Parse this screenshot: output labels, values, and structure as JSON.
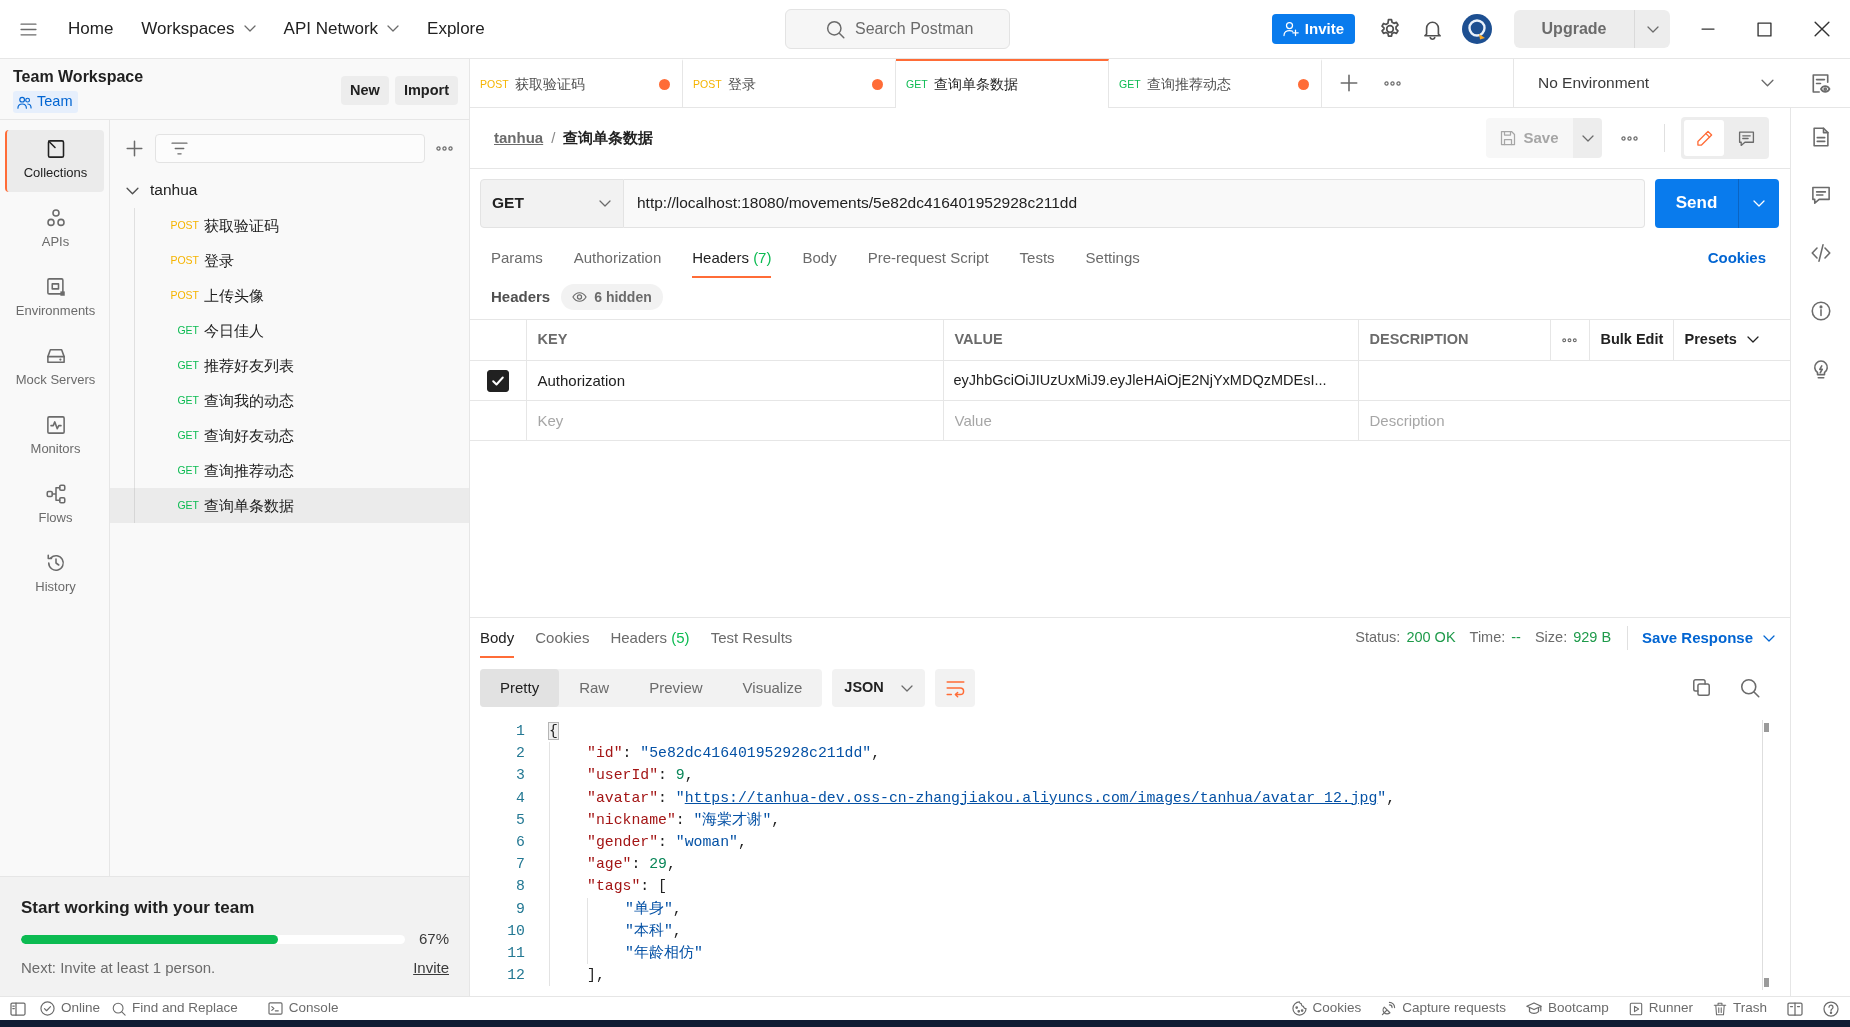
{
  "header": {
    "nav": [
      {
        "label": "Home",
        "dropdown": false
      },
      {
        "label": "Workspaces",
        "dropdown": true
      },
      {
        "label": "API Network",
        "dropdown": true
      },
      {
        "label": "Explore",
        "dropdown": false
      }
    ],
    "search": {
      "placeholder": "Search Postman"
    },
    "invite": "Invite",
    "upgrade": "Upgrade"
  },
  "workspace": {
    "title": "Team Workspace",
    "type": "Team",
    "buttons": [
      "New",
      "Import"
    ]
  },
  "sidebar_nav": [
    {
      "kind": "collections",
      "label": "Collections",
      "selected": true
    },
    {
      "kind": "apis",
      "label": "APIs",
      "selected": false
    },
    {
      "kind": "environments",
      "label": "Environments",
      "selected": false
    },
    {
      "kind": "mock_servers",
      "label": "Mock Servers",
      "selected": false
    },
    {
      "kind": "monitors",
      "label": "Monitors",
      "selected": false
    },
    {
      "kind": "flows",
      "label": "Flows",
      "selected": false
    },
    {
      "kind": "history",
      "label": "History",
      "selected": false
    }
  ],
  "collections": [
    {
      "name": "tanhua",
      "expanded": true,
      "children": [
        {
          "method": "POST",
          "color": "#f5b400",
          "name": "获取验证码",
          "selected": false
        },
        {
          "method": "POST",
          "color": "#f5b400",
          "name": "登录",
          "selected": false
        },
        {
          "method": "POST",
          "color": "#f5b400",
          "name": "上传头像",
          "selected": false
        },
        {
          "method": "GET",
          "color": "#0cbb52",
          "name": "今日佳人",
          "selected": false
        },
        {
          "method": "GET",
          "color": "#0cbb52",
          "name": "推荐好友列表",
          "selected": false
        },
        {
          "method": "GET",
          "color": "#0cbb52",
          "name": "查询我的动态",
          "selected": false
        },
        {
          "method": "GET",
          "color": "#0cbb52",
          "name": "查询好友动态",
          "selected": false
        },
        {
          "method": "GET",
          "color": "#0cbb52",
          "name": "查询推荐动态",
          "selected": false
        },
        {
          "method": "GET",
          "color": "#0cbb52",
          "name": "查询单条数据",
          "selected": true
        }
      ]
    }
  ],
  "team_card": {
    "title": "Start working with your team",
    "level": 0.67,
    "reading": "67%",
    "note": "Next: Invite at least 1 person.",
    "link": "Invite"
  },
  "request_tabs": [
    {
      "method": "POST",
      "color": "#f5b400",
      "name": "获取验证码",
      "selected": false,
      "unsaved": true
    },
    {
      "method": "POST",
      "color": "#f5b400",
      "name": "登录",
      "selected": false,
      "unsaved": true
    },
    {
      "method": "GET",
      "color": "#0cbb52",
      "name": "查询单条数据",
      "selected": true,
      "unsaved": false
    },
    {
      "method": "GET",
      "color": "#0cbb52",
      "name": "查询推荐动态",
      "selected": false,
      "unsaved": true
    }
  ],
  "environment": {
    "value": "No Environment"
  },
  "request": {
    "breadcrumb": {
      "collection": "tanhua",
      "separator": "/",
      "name": "查询单条数据"
    },
    "save": "Save",
    "modes": [
      {
        "kind": "edit",
        "selected": true
      },
      {
        "kind": "comments",
        "selected": false
      }
    ],
    "method": "GET",
    "url": "http://localhost:18080/movements/5e82dc416401952928c211dd",
    "send": "Send",
    "tabs": [
      {
        "label": "Params",
        "selected": false
      },
      {
        "label": "Authorization",
        "selected": false
      },
      {
        "label": "Headers",
        "count": "(7)",
        "selected": true
      },
      {
        "label": "Body",
        "selected": false
      },
      {
        "label": "Pre-request Script",
        "selected": false
      },
      {
        "label": "Tests",
        "selected": false
      },
      {
        "label": "Settings",
        "selected": false
      }
    ],
    "cookies": "Cookies"
  },
  "headers": {
    "title": "Headers",
    "hidden": "6 hidden",
    "columns": [
      "KEY",
      "VALUE",
      "DESCRIPTION"
    ],
    "bulk_edit": "Bulk Edit",
    "presets": "Presets",
    "rows": [
      {
        "checked": true,
        "key": "Authorization",
        "value": "eyJhbGciOiJIUzUxMiJ9.eyJleHAiOjE2NjYxMDQzMDEsI..."
      }
    ],
    "new_row": {
      "key": {
        "placeholder": "Key"
      },
      "value": {
        "placeholder": "Value"
      },
      "description": {
        "placeholder": "Description"
      }
    }
  },
  "response": {
    "tabs": [
      {
        "label": "Body",
        "selected": true
      },
      {
        "label": "Cookies",
        "selected": false
      },
      {
        "label": "Headers",
        "count": "(5)",
        "selected": false
      },
      {
        "label": "Test Results",
        "selected": false
      }
    ],
    "status": {
      "label": "Status:",
      "value": "200 OK"
    },
    "time": {
      "label": "Time:",
      "value": "--"
    },
    "size": {
      "label": "Size:",
      "value": "929 B"
    },
    "save": "Save Response",
    "views": [
      {
        "label": "Pretty",
        "selected": true
      },
      {
        "label": "Raw",
        "selected": false
      },
      {
        "label": "Preview",
        "selected": false
      },
      {
        "label": "Visualize",
        "selected": false
      }
    ],
    "format": "JSON",
    "wrap": true,
    "lines": [
      {
        "number": "1",
        "bracket_highlight": true,
        "tokens": [
          {
            "kind": "punct",
            "text": "{"
          }
        ],
        "children": [
          {
            "number": "2",
            "bracket_highlight": false,
            "tokens": [
              {
                "kind": "key",
                "text": "\"id\""
              },
              {
                "kind": "punct",
                "text": ": "
              },
              {
                "kind": "string",
                "text": "\"5e82dc416401952928c211dd\""
              },
              {
                "kind": "punct",
                "text": ","
              }
            ]
          },
          {
            "number": "3",
            "bracket_highlight": false,
            "tokens": [
              {
                "kind": "key",
                "text": "\"userId\""
              },
              {
                "kind": "punct",
                "text": ": "
              },
              {
                "kind": "number",
                "text": "9"
              },
              {
                "kind": "punct",
                "text": ","
              }
            ]
          },
          {
            "number": "4",
            "bracket_highlight": false,
            "tokens": [
              {
                "kind": "key",
                "text": "\"avatar\""
              },
              {
                "kind": "punct",
                "text": ": "
              },
              {
                "kind": "string",
                "text": "\""
              },
              {
                "kind": "link",
                "text": "https://tanhua-dev.oss-cn-zhangjiakou.aliyuncs.com/images/tanhua/avatar_12.jpg"
              },
              {
                "kind": "string",
                "text": "\""
              },
              {
                "kind": "punct",
                "text": ","
              }
            ]
          },
          {
            "number": "5",
            "bracket_highlight": false,
            "tokens": [
              {
                "kind": "key",
                "text": "\"nickname\""
              },
              {
                "kind": "punct",
                "text": ": "
              },
              {
                "kind": "string",
                "text": "\"海棠才谢\""
              },
              {
                "kind": "punct",
                "text": ","
              }
            ]
          },
          {
            "number": "6",
            "bracket_highlight": false,
            "tokens": [
              {
                "kind": "key",
                "text": "\"gender\""
              },
              {
                "kind": "punct",
                "text": ": "
              },
              {
                "kind": "string",
                "text": "\"woman\""
              },
              {
                "kind": "punct",
                "text": ","
              }
            ]
          },
          {
            "number": "7",
            "bracket_highlight": false,
            "tokens": [
              {
                "kind": "key",
                "text": "\"age\""
              },
              {
                "kind": "punct",
                "text": ": "
              },
              {
                "kind": "number",
                "text": "29"
              },
              {
                "kind": "punct",
                "text": ","
              }
            ]
          },
          {
            "number": "8",
            "bracket_highlight": false,
            "tokens": [
              {
                "kind": "key",
                "text": "\"tags\""
              },
              {
                "kind": "punct",
                "text": ": ["
              }
            ],
            "children": [
              {
                "number": "9",
                "bracket_highlight": false,
                "tokens": [
                  {
                    "kind": "string",
                    "text": "\"单身\""
                  },
                  {
                    "kind": "punct",
                    "text": ","
                  }
                ]
              },
              {
                "number": "10",
                "bracket_highlight": false,
                "tokens": [
                  {
                    "kind": "string",
                    "text": "\"本科\""
                  },
                  {
                    "kind": "punct",
                    "text": ","
                  }
                ]
              },
              {
                "number": "11",
                "bracket_highlight": false,
                "tokens": [
                  {
                    "kind": "string",
                    "text": "\"年龄相仿\""
                  }
                ]
              }
            ]
          },
          {
            "number": "12",
            "bracket_highlight": false,
            "tokens": [
              {
                "kind": "punct",
                "text": "],"
              }
            ]
          }
        ]
      }
    ]
  },
  "status_bar": {
    "left": [
      {
        "kind": "online",
        "label": "Online"
      },
      {
        "kind": "find",
        "label": "Find and Replace"
      },
      {
        "kind": "console",
        "label": "Console"
      }
    ],
    "right": [
      {
        "kind": "cookies",
        "label": "Cookies"
      },
      {
        "kind": "capture",
        "label": "Capture requests"
      },
      {
        "kind": "bootcamp",
        "label": "Bootcamp"
      },
      {
        "kind": "runner",
        "label": "Runner"
      },
      {
        "kind": "trash",
        "label": "Trash"
      }
    ]
  }
}
